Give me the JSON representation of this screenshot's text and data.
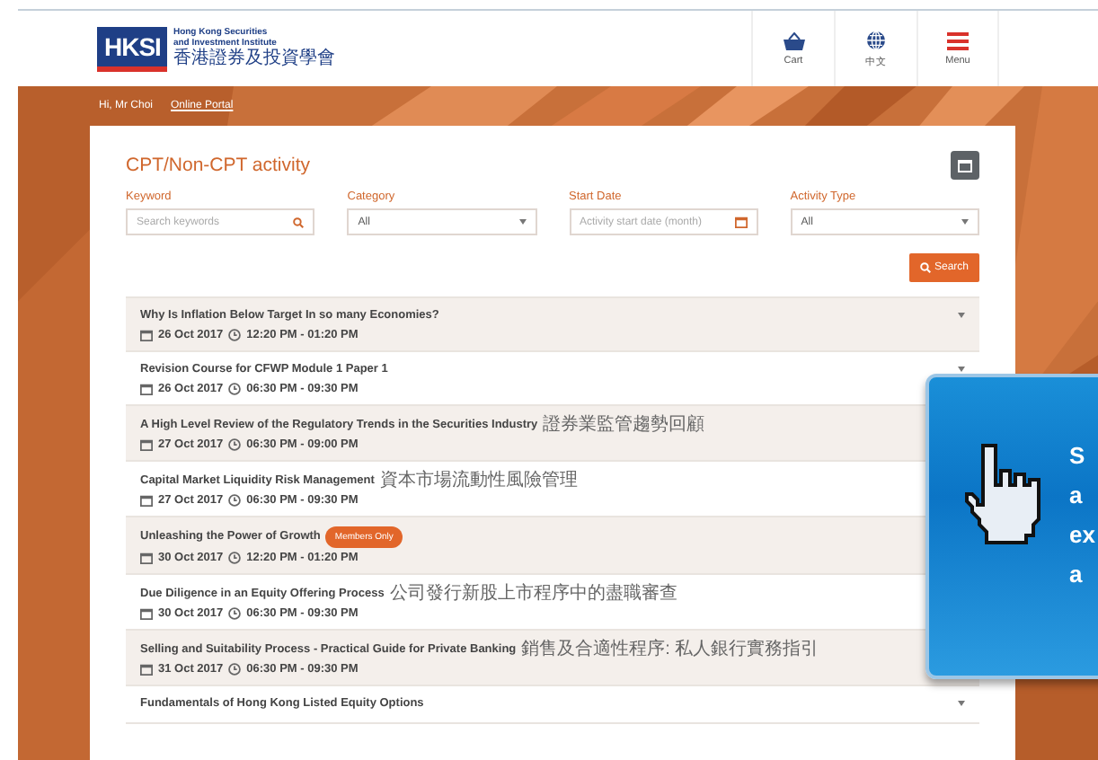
{
  "header": {
    "logo": {
      "abbr": "HKSI",
      "name_en": [
        "Hong Kong Securities",
        "and Investment Institute"
      ],
      "name_zh": "香港證券及投資學會"
    },
    "actions": [
      {
        "label": "Cart",
        "kind": "cart"
      },
      {
        "label": "中文",
        "kind": "globe"
      },
      {
        "label": "Menu",
        "kind": "menu"
      }
    ]
  },
  "greeting": "Hi, Mr Choi",
  "portal_link": "Online Portal",
  "page_title": "CPT/Non-CPT activity",
  "filters": [
    {
      "label": "Keyword",
      "kind": "search",
      "placeholder": "Search keywords"
    },
    {
      "label": "Category",
      "kind": "select",
      "value": "All"
    },
    {
      "label": "Start Date",
      "kind": "date",
      "placeholder": "Activity start date (month)"
    },
    {
      "label": "Activity Type",
      "kind": "select",
      "value": "All"
    }
  ],
  "search_button": "Search",
  "activities": [
    {
      "title": "Why Is Inflation Below Target In so many Economies?",
      "date": "26 Oct 2017",
      "time": "12:20 PM - 01:20 PM"
    },
    {
      "title": "Revision Course for CFWP Module 1 Paper 1",
      "date": "26 Oct 2017",
      "time": "06:30 PM - 09:30 PM"
    },
    {
      "title": "A High Level Review of the Regulatory Trends in the Securities Industry",
      "title_zh": "證券業監管趨勢回顧",
      "date": "27 Oct 2017",
      "time": "06:30 PM - 09:00 PM"
    },
    {
      "title": "Capital Market Liquidity Risk Management",
      "title_zh": "資本市場流動性風險管理",
      "date": "27 Oct 2017",
      "time": "06:30 PM - 09:30 PM"
    },
    {
      "title": "Unleashing the Power of Growth",
      "badge": "Members Only",
      "date": "30 Oct 2017",
      "time": "12:20 PM - 01:20 PM"
    },
    {
      "title": "Due Diligence in an Equity Offering Process",
      "title_zh": "公司發行新股上市程序中的盡職審查",
      "date": "30 Oct 2017",
      "time": "06:30 PM - 09:30 PM"
    },
    {
      "title": "Selling and Suitability Process - Practical Guide for Private Banking",
      "title_zh": "銷售及合適性程序: 私人銀行實務指引",
      "date": "31 Oct 2017",
      "time": "06:30 PM - 09:30 PM"
    },
    {
      "title": "Fundamentals of Hong Kong Listed Equity Options"
    }
  ],
  "callout": {
    "lines": [
      "S",
      "a",
      "ex",
      "a"
    ]
  }
}
